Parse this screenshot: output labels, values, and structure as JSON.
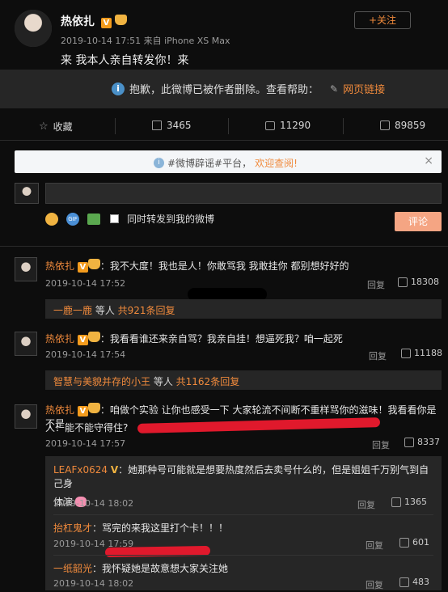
{
  "post": {
    "username": "热依扎",
    "time_source": "2019-10-14 17:51 来自 iPhone XS Max",
    "content": "来 我本人亲自转发你！来",
    "follow_label": "+关注",
    "deleted_notice": "抱歉，此微博已被作者删除。查看帮助：",
    "webpage_link": "网页链接",
    "actions": {
      "favorite": "收藏",
      "repost": "3465",
      "comments": "11290",
      "likes": "89859"
    }
  },
  "rumor_bar": {
    "prefix": "#微博辟谣#平台，",
    "highlight": "欢迎查阅!"
  },
  "composer": {
    "checkbox_label": "同时转发到我的微博",
    "submit_label": "评论"
  },
  "comments": [
    {
      "name": "热依扎",
      "text": "我不大度！我也是人！你敢骂我 我敢挂你 都别想好好的",
      "time": "2019-10-14 17:52",
      "reply": "回复",
      "likes": "18308",
      "sub_summary": {
        "who": "一鹿一鹿",
        "mid": " 等人 ",
        "count": "共921条回复"
      }
    },
    {
      "name": "热依扎",
      "text": "我看看谁还来亲自骂？我亲自挂！想逼死我？咱一起死",
      "time": "2019-10-14 17:54",
      "reply": "回复",
      "likes": "11188",
      "sub_summary": {
        "who": "智慧与美貌并存的小王",
        "mid": " 等人 ",
        "count": "共1162条回复"
      }
    },
    {
      "name": "热依扎",
      "text_line1": "咱做个实验 让你也感受一下 大家轮流不间断不重样骂你的滋味！我看看你是不是",
      "text_line2": "人！能不能守得住?",
      "time": "2019-10-14 17:57",
      "reply": "回复",
      "likes": "8337"
    }
  ],
  "replies": [
    {
      "name": "LEAFx0624",
      "text_line1": "她那种号可能就是想要热度然后去卖号什么的，但是姐姐千万别气到自己身",
      "text_line2": "体演",
      "time": "2019-10-14 18:02",
      "reply": "回复",
      "likes": "1365"
    },
    {
      "name": "抬杠鬼才",
      "text": "骂完的来我这里打个卡！！！",
      "time": "2019-10-14 17:59",
      "reply": "回复",
      "likes": "601"
    },
    {
      "name": "一纸韶光",
      "text": "我怀疑她是故意想大家关注她",
      "time": "2019-10-14 18:02",
      "reply": "回复",
      "likes": "483"
    }
  ]
}
